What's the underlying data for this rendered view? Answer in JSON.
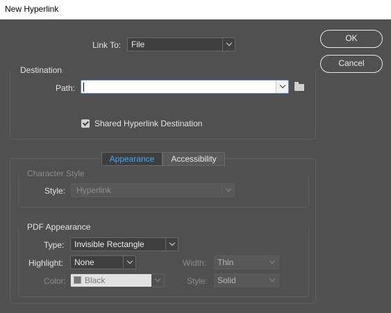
{
  "window": {
    "title": "New Hyperlink"
  },
  "buttons": {
    "ok": "OK",
    "cancel": "Cancel"
  },
  "link_to": {
    "label": "Link To:",
    "value": "File"
  },
  "destination": {
    "legend": "Destination",
    "path_label": "Path:",
    "path_value": "",
    "shared_label": "Shared Hyperlink Destination",
    "shared_checked": true
  },
  "tabs": {
    "appearance": "Appearance",
    "accessibility": "Accessibility",
    "active": "Appearance"
  },
  "character_style": {
    "legend": "Character Style",
    "style_label": "Style:",
    "style_value": "Hyperlink"
  },
  "pdf_appearance": {
    "legend": "PDF Appearance",
    "type_label": "Type:",
    "type_value": "Invisible Rectangle",
    "highlight_label": "Highlight:",
    "highlight_value": "None",
    "width_label": "Width:",
    "width_value": "Thin",
    "color_label": "Color:",
    "color_value": "Black",
    "style_label": "Style:",
    "style_value": "Solid"
  }
}
